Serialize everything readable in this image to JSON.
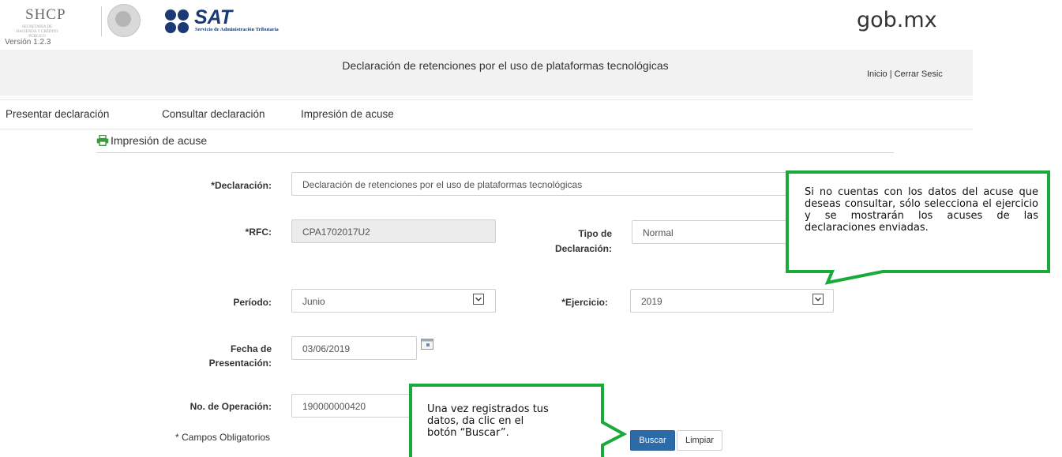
{
  "header": {
    "shcp_logo": "SHCP",
    "shcp_subtitle": "SECRETARÍA DE HACIENDA Y CRÉDITO PÚBLICO",
    "version": "Versión 1.2.3",
    "sat_logo": "SAT",
    "sat_subtitle": "Servicio de Administración Tributaria",
    "gob_logo": "gob.mx"
  },
  "page": {
    "title": "Declaración de retenciones por el uso de plataformas tecnológicas",
    "top_nav": "Inicio | Cerrar Sesic"
  },
  "menu": {
    "items": [
      "Presentar declaración",
      "Consultar declaración",
      "Impresión de acuse"
    ]
  },
  "section": {
    "title": "Impresión de acuse"
  },
  "form": {
    "declaracion_label": "*Declaración:",
    "declaracion_value": "Declaración de retenciones por el uso de plataformas tecnológicas",
    "rfc_label": "*RFC:",
    "rfc_value": "CPA1702017U2",
    "tipo_label_1": "Tipo de",
    "tipo_label_2": "Declaración:",
    "tipo_value": "Normal",
    "periodo_label": "Período:",
    "periodo_value": "Junio",
    "ejercicio_label": "*Ejercicio:",
    "ejercicio_value": "2019",
    "fecha_label_1": "Fecha de",
    "fecha_label_2": "Presentación:",
    "fecha_value": "03/06/2019",
    "operacion_label": "No. de Operación:",
    "operacion_value": "190000000420",
    "required_note": "* Campos Obligatorios",
    "buscar": "Buscar",
    "limpiar": "Limpiar"
  },
  "callouts": {
    "top": "Si no cuentas con los datos del acuse que deseas consultar, sólo selecciona el ejercicio y se mostrarán los acuses de las declaraciones enviadas.",
    "bottom_1": "Una vez registrados tus",
    "bottom_2": "datos, da clic en el",
    "bottom_3": "botón “Buscar”."
  },
  "colors": {
    "callout_border": "#1aaa3a",
    "primary_button": "#2d6aa8",
    "sat_blue": "#1b3a73",
    "printer_icon": "#3a9a3a"
  }
}
